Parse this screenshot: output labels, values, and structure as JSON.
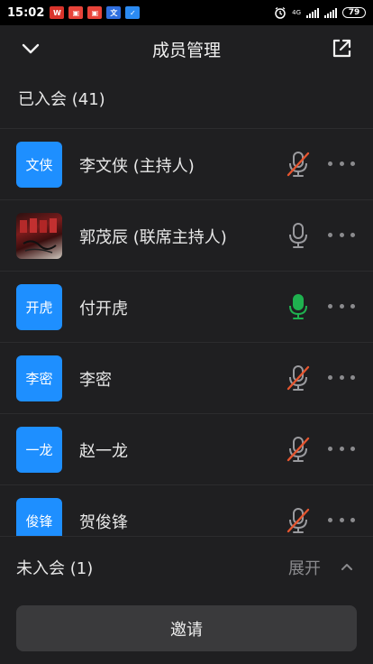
{
  "status_bar": {
    "time": "15:02",
    "app_icons": [
      {
        "name": "wps-icon",
        "glyph": "W",
        "color": "#d9342b"
      },
      {
        "name": "news-icon",
        "glyph": "头条",
        "color": "#e8443a"
      },
      {
        "name": "news2-icon",
        "glyph": "头条",
        "color": "#e8443a"
      },
      {
        "name": "translate-icon",
        "glyph": "文",
        "color": "#2f6fe0"
      },
      {
        "name": "app-icon",
        "glyph": "✓",
        "color": "#2b8bf2"
      }
    ],
    "network_label": "4G",
    "battery": "79"
  },
  "header": {
    "title": "成员管理",
    "back_icon": "chevron-down-icon",
    "share_icon": "external-link-icon"
  },
  "joined": {
    "label": "已入会 (41)",
    "members": [
      {
        "avatar_text": "文侠",
        "name": "李文侠 (主持人)",
        "mic": "muted"
      },
      {
        "avatar_text": "",
        "avatar_photo": true,
        "name": "郭茂辰 (联席主持人)",
        "mic": "idle"
      },
      {
        "avatar_text": "开虎",
        "name": "付开虎",
        "mic": "active"
      },
      {
        "avatar_text": "李密",
        "name": "李密",
        "mic": "muted"
      },
      {
        "avatar_text": "一龙",
        "name": "赵一龙",
        "mic": "muted"
      },
      {
        "avatar_text": "俊锋",
        "name": "贺俊锋",
        "mic": "muted"
      }
    ]
  },
  "not_joined": {
    "label": "未入会 (1)",
    "expand_label": "展开"
  },
  "invite_button": "邀请",
  "colors": {
    "background": "#1f1f21",
    "avatar": "#1e8fff",
    "mic_muted_slash": "#e5552f",
    "mic_active": "#1fb14f",
    "mic_idle": "#9a9a9e"
  }
}
